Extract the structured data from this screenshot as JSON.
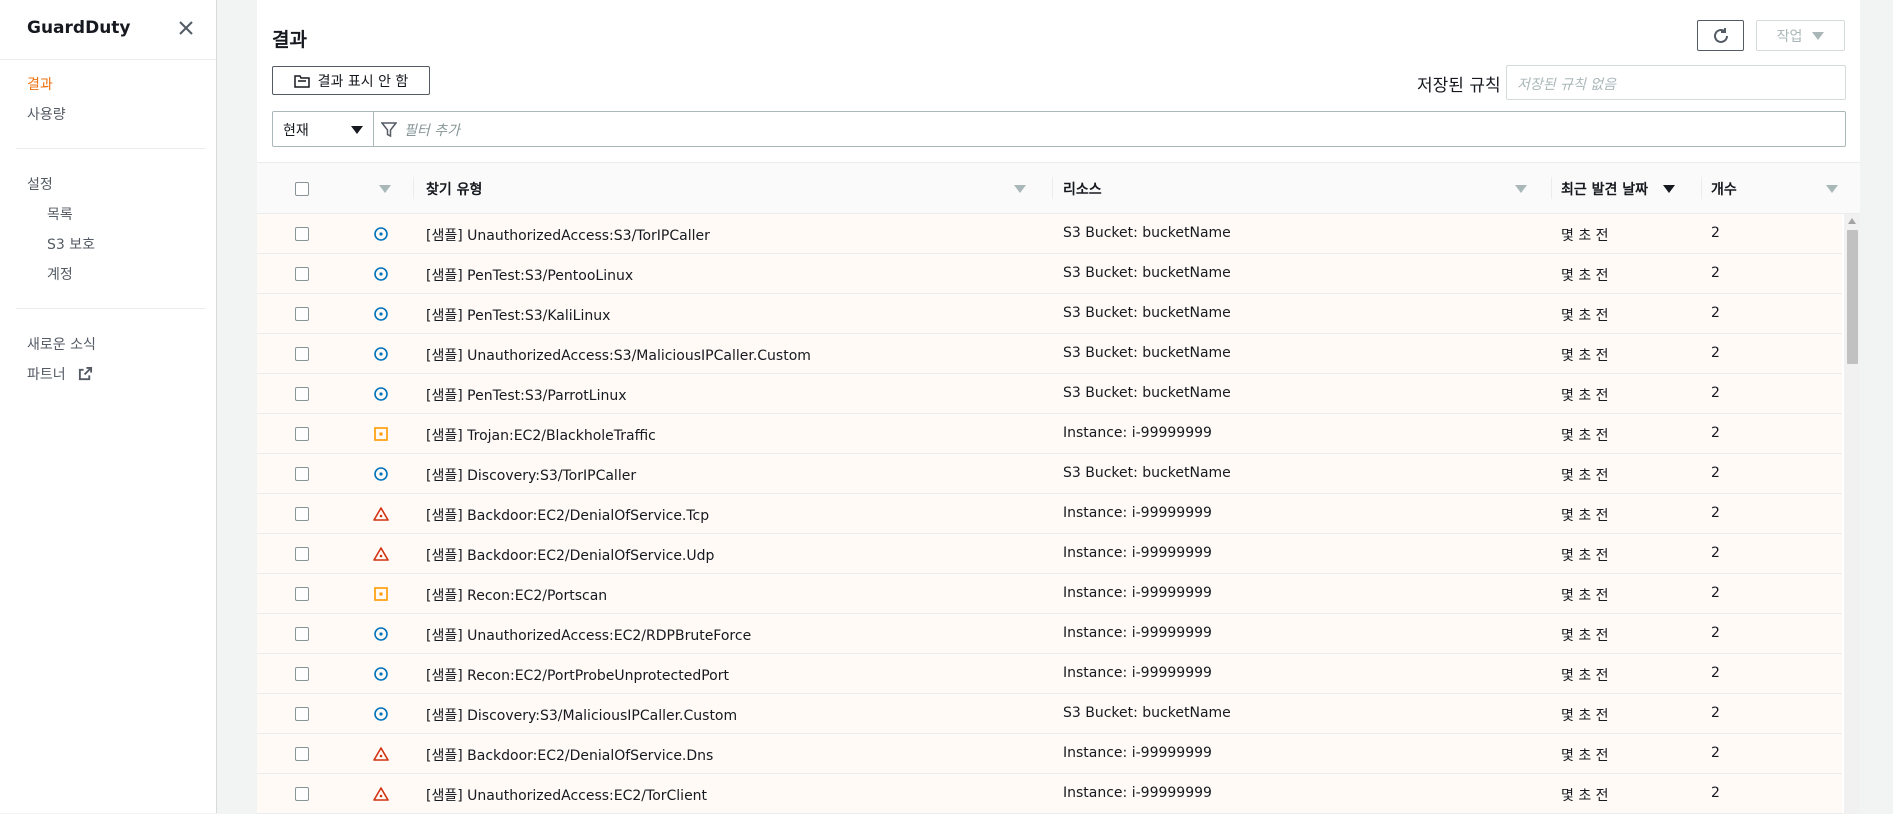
{
  "sidebar": {
    "title": "GuardDuty",
    "items": [
      {
        "label": "결과",
        "active": true
      },
      {
        "label": "사용량",
        "active": false
      }
    ],
    "settings_section": "설정",
    "settings_items": [
      {
        "label": "목록"
      },
      {
        "label": "S3 보호"
      },
      {
        "label": "계정"
      }
    ],
    "footer_items": [
      {
        "label": "새로운 소식"
      },
      {
        "label": "파트너"
      }
    ]
  },
  "header": {
    "title": "결과",
    "actions_label": "작업",
    "suppress_label": "결과 표시 안 함",
    "saved_rules_label": "저장된 규칙",
    "saved_rules_placeholder": "저장된 규칙 없음"
  },
  "filter": {
    "selected": "현재",
    "placeholder": "필터 추가"
  },
  "table": {
    "columns": [
      "찾기 유형",
      "리소스",
      "최근 발견 날짜",
      "개수"
    ],
    "rows": [
      {
        "severity": "low",
        "type": "[샘플] UnauthorizedAccess:S3/TorIPCaller",
        "resource": "S3 Bucket: bucketName",
        "last_seen": "몇 초 전",
        "count": "2"
      },
      {
        "severity": "low",
        "type": "[샘플] PenTest:S3/PentooLinux",
        "resource": "S3 Bucket: bucketName",
        "last_seen": "몇 초 전",
        "count": "2"
      },
      {
        "severity": "low",
        "type": "[샘플] PenTest:S3/KaliLinux",
        "resource": "S3 Bucket: bucketName",
        "last_seen": "몇 초 전",
        "count": "2"
      },
      {
        "severity": "low",
        "type": "[샘플] UnauthorizedAccess:S3/MaliciousIPCaller.Custom",
        "resource": "S3 Bucket: bucketName",
        "last_seen": "몇 초 전",
        "count": "2"
      },
      {
        "severity": "low",
        "type": "[샘플] PenTest:S3/ParrotLinux",
        "resource": "S3 Bucket: bucketName",
        "last_seen": "몇 초 전",
        "count": "2"
      },
      {
        "severity": "medium",
        "type": "[샘플] Trojan:EC2/BlackholeTraffic",
        "resource": "Instance: i-99999999",
        "last_seen": "몇 초 전",
        "count": "2"
      },
      {
        "severity": "low",
        "type": "[샘플] Discovery:S3/TorIPCaller",
        "resource": "S3 Bucket: bucketName",
        "last_seen": "몇 초 전",
        "count": "2"
      },
      {
        "severity": "high",
        "type": "[샘플] Backdoor:EC2/DenialOfService.Tcp",
        "resource": "Instance: i-99999999",
        "last_seen": "몇 초 전",
        "count": "2"
      },
      {
        "severity": "high",
        "type": "[샘플] Backdoor:EC2/DenialOfService.Udp",
        "resource": "Instance: i-99999999",
        "last_seen": "몇 초 전",
        "count": "2"
      },
      {
        "severity": "medium",
        "type": "[샘플] Recon:EC2/Portscan",
        "resource": "Instance: i-99999999",
        "last_seen": "몇 초 전",
        "count": "2"
      },
      {
        "severity": "low",
        "type": "[샘플] UnauthorizedAccess:EC2/RDPBruteForce",
        "resource": "Instance: i-99999999",
        "last_seen": "몇 초 전",
        "count": "2"
      },
      {
        "severity": "low",
        "type": "[샘플] Recon:EC2/PortProbeUnprotectedPort",
        "resource": "Instance: i-99999999",
        "last_seen": "몇 초 전",
        "count": "2"
      },
      {
        "severity": "low",
        "type": "[샘플] Discovery:S3/MaliciousIPCaller.Custom",
        "resource": "S3 Bucket: bucketName",
        "last_seen": "몇 초 전",
        "count": "2"
      },
      {
        "severity": "high",
        "type": "[샘플] Backdoor:EC2/DenialOfService.Dns",
        "resource": "Instance: i-99999999",
        "last_seen": "몇 초 전",
        "count": "2"
      },
      {
        "severity": "high",
        "type": "[샘플] UnauthorizedAccess:EC2/TorClient",
        "resource": "Instance: i-99999999",
        "last_seen": "몇 초 전",
        "count": "2"
      }
    ]
  },
  "colors": {
    "accent": "#ec7211",
    "severity_low": "#0073bb",
    "severity_medium": "#ff9900",
    "severity_high": "#d13212",
    "row_bg": "#fffaf6"
  },
  "icons": {
    "close": "close-icon",
    "external": "external-link-icon",
    "refresh": "refresh-icon",
    "suppress": "folder-icon",
    "filter": "filter-icon",
    "severity_low": "severity-low-icon",
    "severity_medium": "severity-medium-icon",
    "severity_high": "severity-high-icon"
  }
}
